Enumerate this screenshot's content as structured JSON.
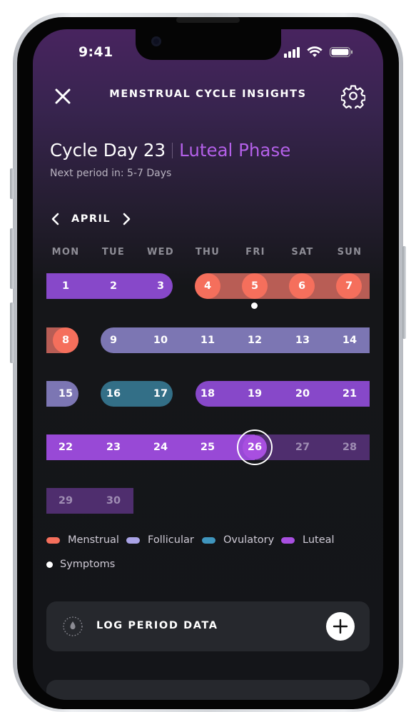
{
  "status_bar": {
    "time": "9:41"
  },
  "topbar": {
    "title": "MENSTRUAL CYCLE INSIGHTS"
  },
  "header": {
    "cycle_day": "Cycle Day 23",
    "phase": "Luteal Phase",
    "next_period": "Next period in: 5-7 Days"
  },
  "calendar": {
    "month": "APRIL",
    "weekdays": [
      "MON",
      "TUE",
      "WED",
      "THU",
      "FRI",
      "SAT",
      "SUN"
    ],
    "days": [
      "1",
      "2",
      "3",
      "4",
      "5",
      "6",
      "7",
      "8",
      "9",
      "10",
      "11",
      "12",
      "13",
      "14",
      "15",
      "16",
      "17",
      "18",
      "19",
      "20",
      "21",
      "22",
      "23",
      "24",
      "25",
      "26",
      "27",
      "28",
      "29",
      "30"
    ],
    "selected_day": "26",
    "symptom_days": [
      "5"
    ]
  },
  "legend": {
    "menstrual": "Menstrual",
    "follicular": "Follicular",
    "ovulatory": "Ovulatory",
    "luteal": "Luteal",
    "symptoms": "Symptoms"
  },
  "colors": {
    "menstrual": "#f56f5c",
    "follicular": "#a9a3e6",
    "ovulatory": "#3f95bd",
    "luteal": "#a84fe0",
    "accent_phase_text": "#b360e8"
  },
  "icons": {
    "close": "close-icon",
    "settings": "gear-icon",
    "prev": "chevron-left-icon",
    "next": "chevron-right-icon",
    "period": "droplet-icon",
    "add": "plus-icon"
  },
  "log_card": {
    "label": "LOG PERIOD DATA"
  }
}
